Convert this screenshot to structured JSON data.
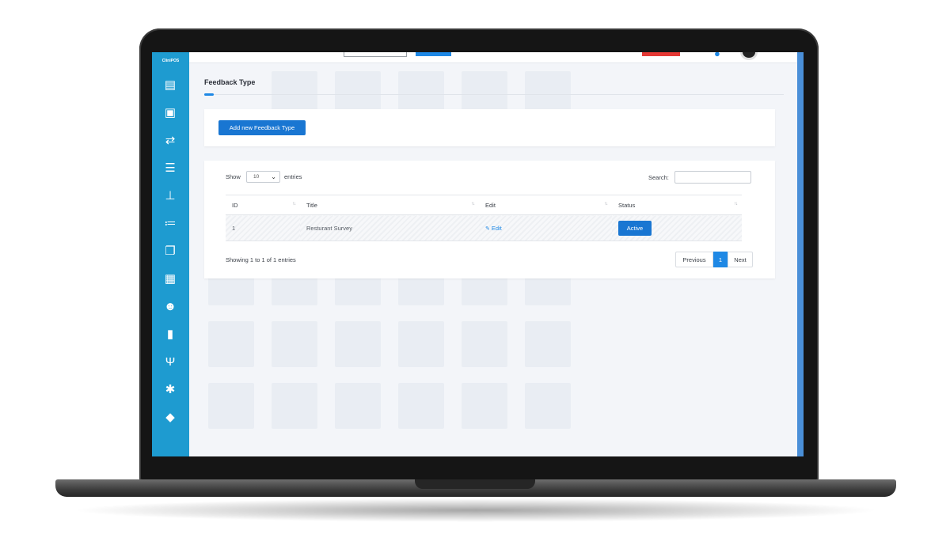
{
  "app": {
    "brand": "CliniPOS"
  },
  "sidebar": {
    "items": [
      {
        "name": "dashboard-icon",
        "glyph": "▤"
      },
      {
        "name": "cash-icon",
        "glyph": "▣"
      },
      {
        "name": "transfer-icon",
        "glyph": "⇄"
      },
      {
        "name": "server-icon",
        "glyph": "☰"
      },
      {
        "name": "sitemap-icon",
        "glyph": "⊥"
      },
      {
        "name": "list-icon",
        "glyph": "≔"
      },
      {
        "name": "copy-icon",
        "glyph": "❐"
      },
      {
        "name": "calculator-icon",
        "glyph": "▦"
      },
      {
        "name": "users-icon",
        "glyph": "☻"
      },
      {
        "name": "file-icon",
        "glyph": "▮"
      },
      {
        "name": "cutlery-icon",
        "glyph": "Ψ"
      },
      {
        "name": "gear-icon",
        "glyph": "✱"
      },
      {
        "name": "comments-icon",
        "glyph": "◆"
      }
    ]
  },
  "page": {
    "title": "Feedback Type"
  },
  "actions": {
    "add_label": "Add new Feedback Type"
  },
  "table_controls": {
    "show_label": "Show",
    "length_value": "10",
    "entries_label": "entries",
    "search_label": "Search:",
    "search_value": ""
  },
  "table": {
    "columns": [
      "ID",
      "Title",
      "Edit",
      "Status"
    ],
    "rows": [
      {
        "id": "1",
        "title": "Resturant Survey",
        "edit": "Edit",
        "status": "Active"
      }
    ]
  },
  "footer": {
    "info": "Showing 1 to 1 of 1 entries",
    "previous": "Previous",
    "page": "1",
    "next": "Next"
  },
  "colors": {
    "sidebar": "#1e9bd0",
    "primary": "#1976d2",
    "page_bg": "#f3f5f9"
  }
}
